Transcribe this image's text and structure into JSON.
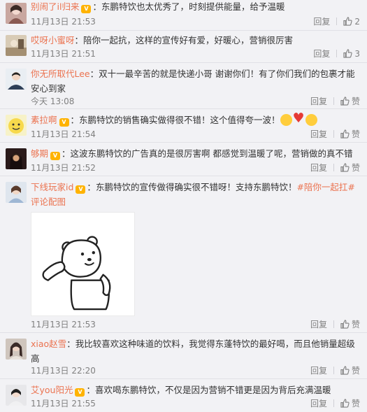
{
  "like_label": "赞",
  "reply_label": "回复",
  "badge_color": "#ffb300",
  "comments": [
    {
      "user": "别闹了il归来",
      "text": "东鹏特饮也太优秀了，时刻提供能量，给予温暖",
      "time": "11月13日 21:53",
      "likes": "2"
    },
    {
      "user": "哎呀小蜜呀",
      "text": "陪你一起抗，这样的宣传好有爱，好暖心，营销很厉害",
      "time": "11月13日 21:51",
      "likes": "3"
    },
    {
      "user": "你无所取代Lee",
      "text": "双十一最辛苦的就是快递小哥  谢谢你们！有了你们我们的包裹才能安心到家",
      "time": "今天 13:08",
      "likes": "赞"
    },
    {
      "user": "素拉啊",
      "text": "东鹏特饮的销售确实做得很不错！这个值得夸一波！",
      "time": "11月13日 21:54",
      "likes": "赞",
      "emojis": [
        "grin",
        "heart",
        "wow"
      ]
    },
    {
      "user": "够期",
      "text": "这波东鹏特饮的广告真的是很厉害啊 都感觉到温暖了呢，营销做的真不错",
      "time": "11月13日 21:52",
      "likes": "赞"
    },
    {
      "user": "下线玩家id",
      "text": "东鹏特饮的宣传做得确实很不错呀！支持东鹏特饮！",
      "tag": "#陪你一起扛#",
      "pic_link": "评论配图",
      "time": "11月13日 21:53",
      "likes": "赞"
    },
    {
      "user": "xiao赵雪",
      "text": "我比较喜欢这种味道的饮料，我觉得东蓬特饮的最好喝，而且他销量超级高",
      "time": "11月13日 22:20",
      "likes": "赞"
    },
    {
      "user": "艾you阳光",
      "text": "喜欢喝东鹏特饮，不仅是因为营销不错更是因为背后充满温暖",
      "time": "11月13日 21:55",
      "likes": "赞"
    }
  ]
}
